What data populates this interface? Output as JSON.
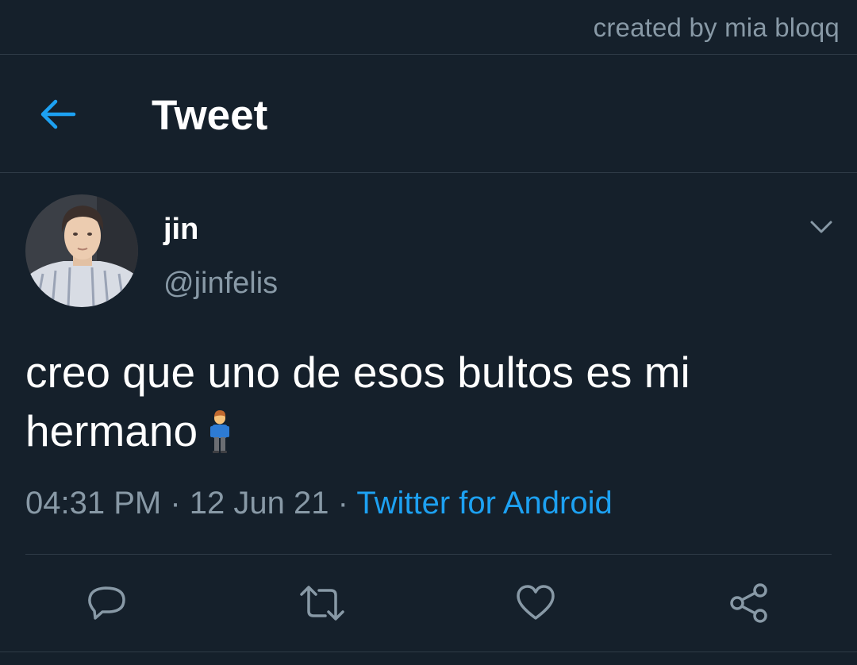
{
  "watermark": "created by mia bloqq",
  "header": {
    "back_icon": "arrow-left-icon",
    "title": "Tweet"
  },
  "tweet": {
    "display_name": "jin",
    "handle": "@jinfelis",
    "text": "creo que uno de esos bultos es mi hermano",
    "emoji": "standing-man-emoji",
    "time": "04:31 PM",
    "date": "12 Jun 21",
    "separator": "·",
    "source": "Twitter for Android"
  },
  "actions": {
    "reply_icon": "reply-icon",
    "retweet_icon": "retweet-icon",
    "like_icon": "heart-icon",
    "share_icon": "share-icon"
  },
  "colors": {
    "background": "#15202b",
    "accent": "#1da1f2",
    "secondary_text": "#8899a6",
    "divider": "#2f3b47"
  }
}
